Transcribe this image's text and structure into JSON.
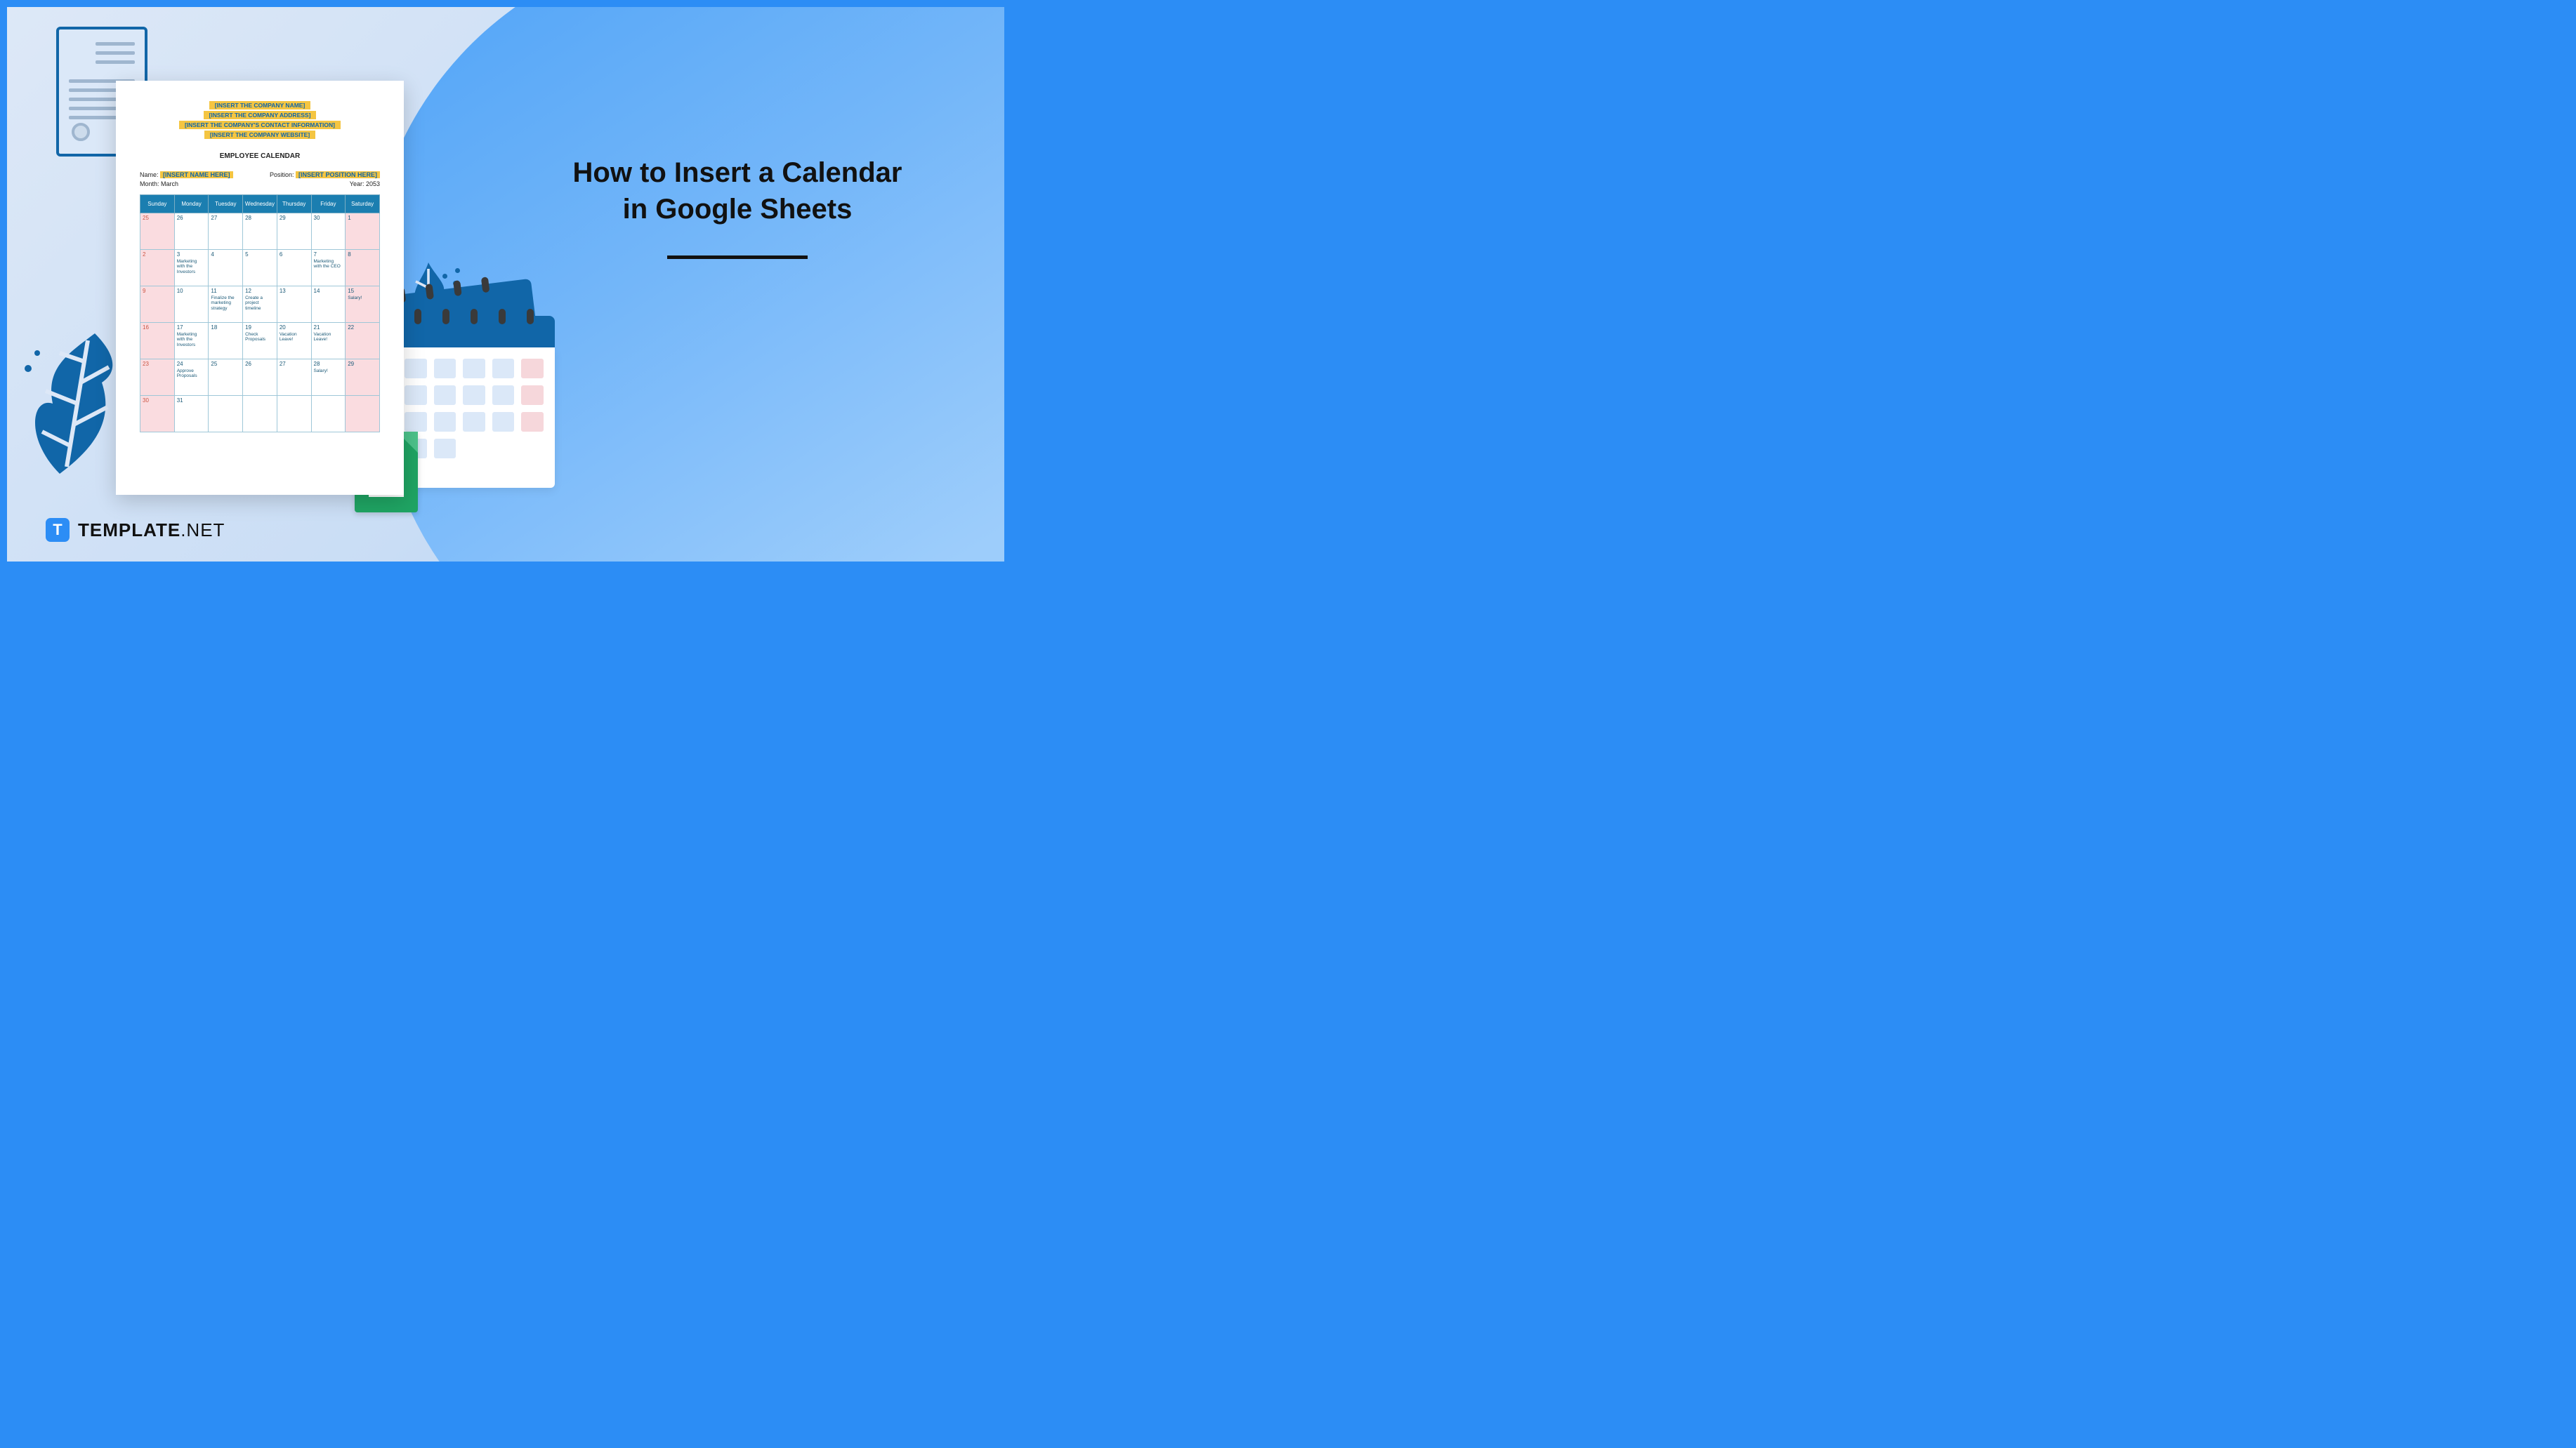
{
  "headline": {
    "line1": "How to Insert a Calendar",
    "line2": "in Google Sheets"
  },
  "logo": {
    "badge": "T",
    "brand": "TEMPLATE",
    "suffix": ".NET"
  },
  "document": {
    "company_lines": [
      "[INSERT THE COMPANY NAME]",
      "[INSERT THE COMPANY ADDRESS]",
      "[INSERT THE COMPANY'S CONTACT INFORMATION]",
      "[INSERT THE COMPANY WEBSITE]"
    ],
    "title": "EMPLOYEE CALENDAR",
    "meta": {
      "name_label": "Name:",
      "name_value": "[INSERT NAME HERE]",
      "position_label": "Position:",
      "position_value": "[INSERT POSITION HERE]",
      "month_label": "Month:",
      "month_value": "March",
      "year_label": "Year:",
      "year_value": "2053"
    },
    "days": [
      "Sunday",
      "Monday",
      "Tuesday",
      "Wednesday",
      "Thursday",
      "Friday",
      "Saturday"
    ],
    "weeks": [
      [
        {
          "num": "25",
          "sun": true
        },
        {
          "num": "26"
        },
        {
          "num": "27"
        },
        {
          "num": "28"
        },
        {
          "num": "29"
        },
        {
          "num": "30"
        },
        {
          "num": "1",
          "sat": true
        }
      ],
      [
        {
          "num": "2",
          "sun": true
        },
        {
          "num": "3",
          "ev": "Marketing with the Investors"
        },
        {
          "num": "4"
        },
        {
          "num": "5"
        },
        {
          "num": "6"
        },
        {
          "num": "7",
          "ev": "Marketing with the CEO"
        },
        {
          "num": "8",
          "sat": true
        }
      ],
      [
        {
          "num": "9",
          "sun": true
        },
        {
          "num": "10"
        },
        {
          "num": "11",
          "ev": "Finalize the marketing strategy"
        },
        {
          "num": "12",
          "ev": "Create a project timeline"
        },
        {
          "num": "13"
        },
        {
          "num": "14"
        },
        {
          "num": "15",
          "sat": true,
          "ev": "Salary!"
        }
      ],
      [
        {
          "num": "16",
          "sun": true
        },
        {
          "num": "17",
          "ev": "Marketing with the Investors"
        },
        {
          "num": "18"
        },
        {
          "num": "19",
          "ev": "Check Proposals"
        },
        {
          "num": "20",
          "ev": "Vacation Leave!"
        },
        {
          "num": "21",
          "ev": "Vacation Leave!"
        },
        {
          "num": "22",
          "sat": true
        }
      ],
      [
        {
          "num": "23",
          "sun": true
        },
        {
          "num": "24",
          "ev": "Approve Proposals"
        },
        {
          "num": "25"
        },
        {
          "num": "26"
        },
        {
          "num": "27"
        },
        {
          "num": "28",
          "ev": "Salary!"
        },
        {
          "num": "29",
          "sat": true
        }
      ],
      [
        {
          "num": "30",
          "sun": true
        },
        {
          "num": "31"
        },
        {
          "num": ""
        },
        {
          "num": ""
        },
        {
          "num": ""
        },
        {
          "num": ""
        },
        {
          "num": "",
          "sat": true
        }
      ]
    ]
  }
}
